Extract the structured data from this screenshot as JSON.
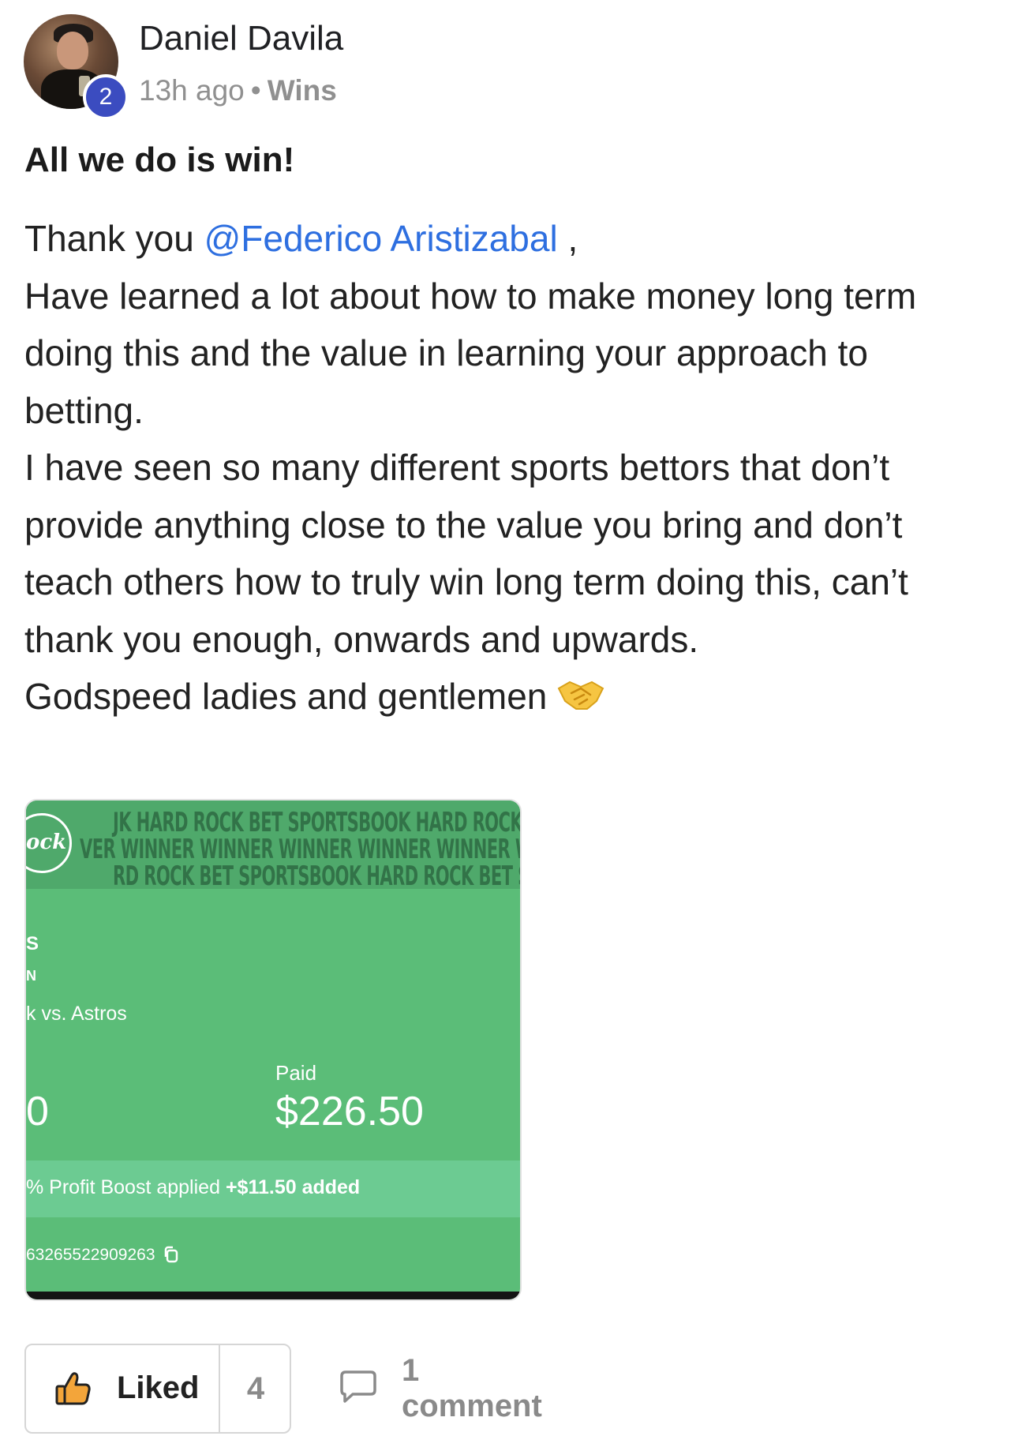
{
  "author": {
    "name": "Daniel Davila",
    "level": "2"
  },
  "meta": {
    "time": "13h ago",
    "separator": "•",
    "category": "Wins"
  },
  "post": {
    "title": "All we do is win!",
    "lines": [
      {
        "pre": "Thank you ",
        "mention": "@Federico Aristizabal",
        "post": " ,"
      },
      {
        "text": "Have learned a lot about how to make money long term"
      },
      {
        "text": "doing this and the value in learning your approach to"
      },
      {
        "text": "betting."
      },
      {
        "text": "I have seen so many different sports bettors that don’t"
      },
      {
        "text": "provide anything close to the value you bring and don’t"
      },
      {
        "text": "teach others how to truly win long term doing this, can’t"
      },
      {
        "text": "thank you enough, onwards and upwards."
      },
      {
        "text": "Godspeed ladies and gentlemen",
        "emoji": "handshake-emoji"
      }
    ]
  },
  "attachment": {
    "logo_text": "ock",
    "banner_1": "JK HARD ROCK BET SPORTSBOOK HARD ROCK BET SPO",
    "banner_2": "VER WINNER WINNER WINNER WINNER WINNER WINNER WINNI",
    "banner_3": "RD ROCK BET SPORTSBOOK HARD ROCK BET SPORTS",
    "frag_1": "S",
    "frag_2": "N",
    "matchup": "k vs. Astros",
    "wager_fragment": "0",
    "paid_label": "Paid",
    "paid_value": "$226.50",
    "boost_text": "% Profit Boost applied",
    "boost_added": "+$11.50 added",
    "bet_id": "63265522909263",
    "copy_icon": "copy-icon"
  },
  "actions": {
    "like_label": "Liked",
    "like_count": "4",
    "comment_label": "1 comment"
  },
  "colors": {
    "mention": "#2e6fe0",
    "level_badge": "#3b4cc0",
    "slip_green": "#5bbd78",
    "slip_boost": "#6ccb92"
  }
}
